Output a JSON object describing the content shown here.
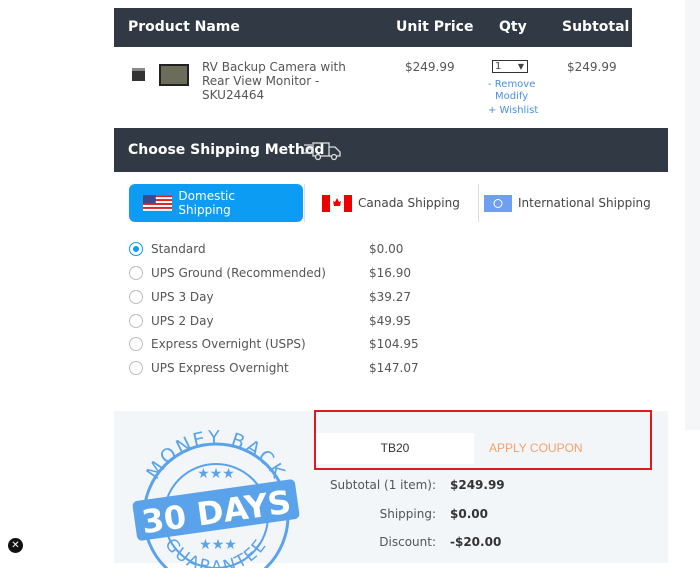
{
  "cart": {
    "headers": [
      "Product Name",
      "Unit Price",
      "Qty",
      "Subtotal"
    ],
    "item": {
      "name_line1": "RV Backup Camera with",
      "name_line2": "Rear View Monitor -",
      "name_line3": "SKU24464",
      "unit_price": "$249.99",
      "qty": "1",
      "subtotal": "$249.99",
      "remove": "- Remove",
      "modify": "Modify",
      "wishlist": "+ Wishlist"
    }
  },
  "shipping": {
    "title": "Choose Shipping Method",
    "tabs": [
      {
        "label": "Domestic Shipping",
        "active": true
      },
      {
        "label": "Canada Shipping"
      },
      {
        "label": "International Shipping"
      }
    ],
    "options": [
      {
        "label": "Standard",
        "price": "$0.00",
        "selected": true
      },
      {
        "label": "UPS Ground (Recommended)",
        "price": "$16.90"
      },
      {
        "label": "UPS 3 Day",
        "price": "$39.27"
      },
      {
        "label": "UPS 2 Day",
        "price": "$49.95"
      },
      {
        "label": "Express Overnight (USPS)",
        "price": "$104.95"
      },
      {
        "label": "UPS Express Overnight",
        "price": "$147.07"
      }
    ]
  },
  "summary": {
    "coupon_value": "TB20",
    "apply_label": "APPLY COUPON",
    "subtotal_label": "Subtotal (1 item):",
    "subtotal": "$249.99",
    "shipping_label": "Shipping:",
    "shipping": "$0.00",
    "discount_label": "Discount:",
    "discount": "-$20.00"
  },
  "seal": {
    "top": "MONEY BACK",
    "middle": "30 DAYS",
    "bottom": "GUARANTEE",
    "color": "#5aa3ea"
  },
  "colors": {
    "header": "#313a44",
    "accent": "#0d9cf3",
    "highlight": "#e0191f"
  }
}
